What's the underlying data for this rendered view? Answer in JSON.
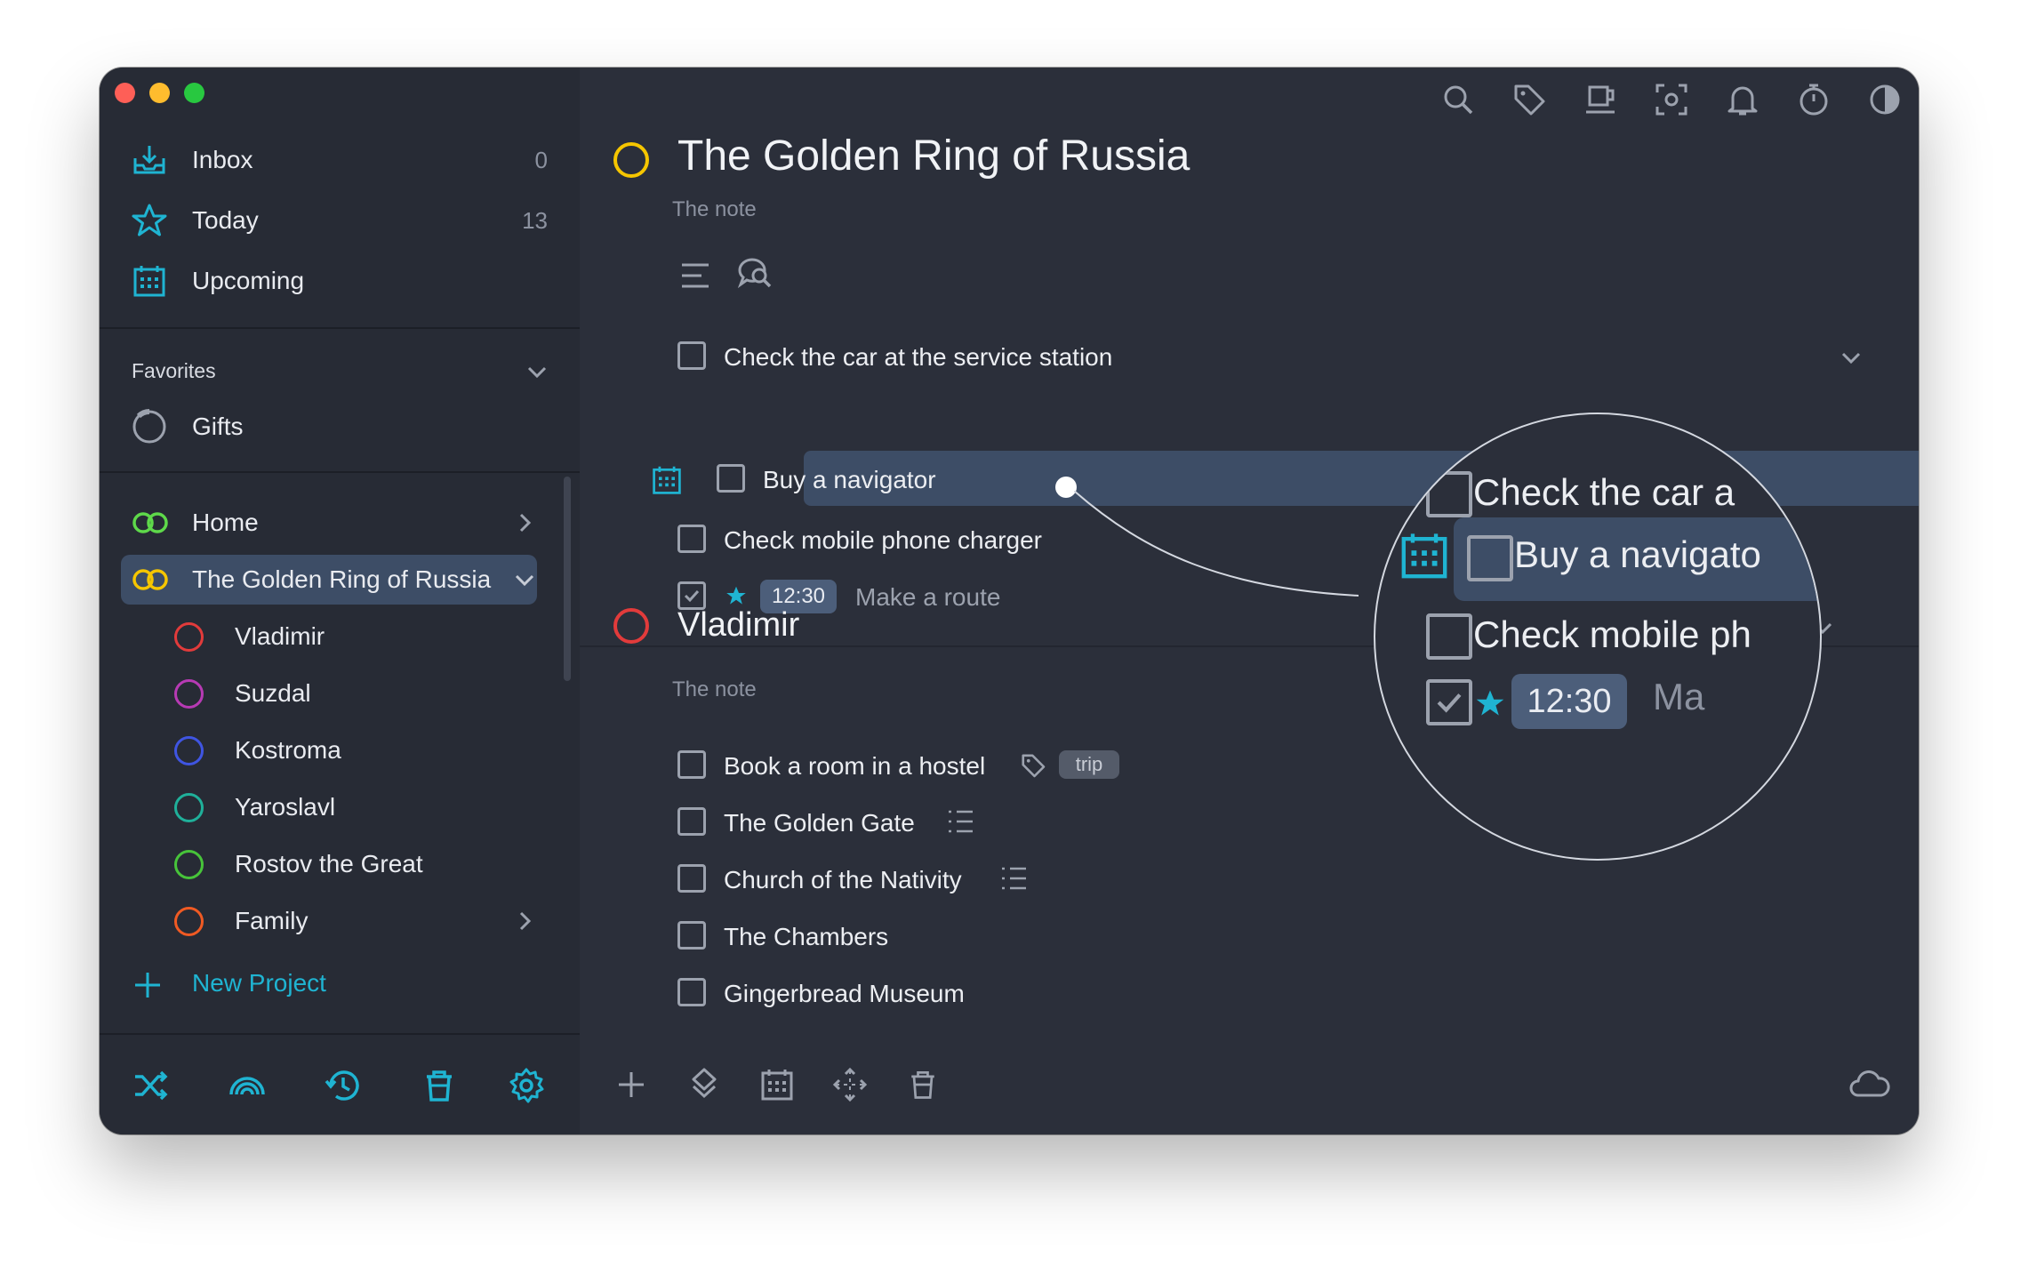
{
  "sidebar": {
    "nav": [
      {
        "label": "Inbox",
        "count": "0",
        "icon": "inbox-icon"
      },
      {
        "label": "Today",
        "count": "13",
        "icon": "star-icon"
      },
      {
        "label": "Upcoming",
        "count": "",
        "icon": "calendar-icon"
      }
    ],
    "favorites": {
      "title": "Favorites",
      "items": [
        {
          "label": "Gifts"
        }
      ]
    },
    "projects": [
      {
        "label": "Home",
        "color": "#5ed94a"
      },
      {
        "label": "The Golden Ring of Russia",
        "color": "#f6c600"
      }
    ],
    "subprojects": [
      {
        "label": "Vladimir",
        "color": "#e23b3b"
      },
      {
        "label": "Suzdal",
        "color": "#b73ab4"
      },
      {
        "label": "Kostroma",
        "color": "#3f55e2"
      },
      {
        "label": "Yaroslavl",
        "color": "#1fb09a"
      },
      {
        "label": "Rostov the Great",
        "color": "#47c43a"
      },
      {
        "label": "Family",
        "color": "#f05a23"
      }
    ],
    "new_project": "New Project"
  },
  "toolbar": {
    "icons": [
      "search-icon",
      "tag-icon",
      "coffee-icon",
      "focus-icon",
      "bell-icon",
      "timer-icon",
      "contrast-icon",
      "windows-icon"
    ]
  },
  "main": {
    "project1": {
      "title": "The Golden Ring of Russia",
      "note": "The note",
      "ring_color": "#f6c600",
      "tasks": [
        {
          "text": "Check the car at the service station"
        },
        {
          "text": "Buy a navigator"
        },
        {
          "text": "Check mobile phone charger"
        },
        {
          "text": "Make a route",
          "time": "12:30"
        }
      ]
    },
    "project2": {
      "title": "Vladimir",
      "note": "The note",
      "ring_color": "#e23b3b",
      "tasks": [
        {
          "text": "Book a room in a hostel",
          "tag": "trip"
        },
        {
          "text": "The Golden Gate"
        },
        {
          "text": "Church of the Nativity"
        },
        {
          "text": "The Chambers"
        },
        {
          "text": "Gingerbread Museum"
        }
      ]
    }
  },
  "magnifier": {
    "lines": [
      "Check the car a",
      "Buy a navigato",
      "Check mobile ph",
      "Ma"
    ],
    "time": "12:30"
  },
  "colors": {
    "accent": "#1fb4d2",
    "highlight": "#3d4d66",
    "background": "#2b2f3a"
  }
}
